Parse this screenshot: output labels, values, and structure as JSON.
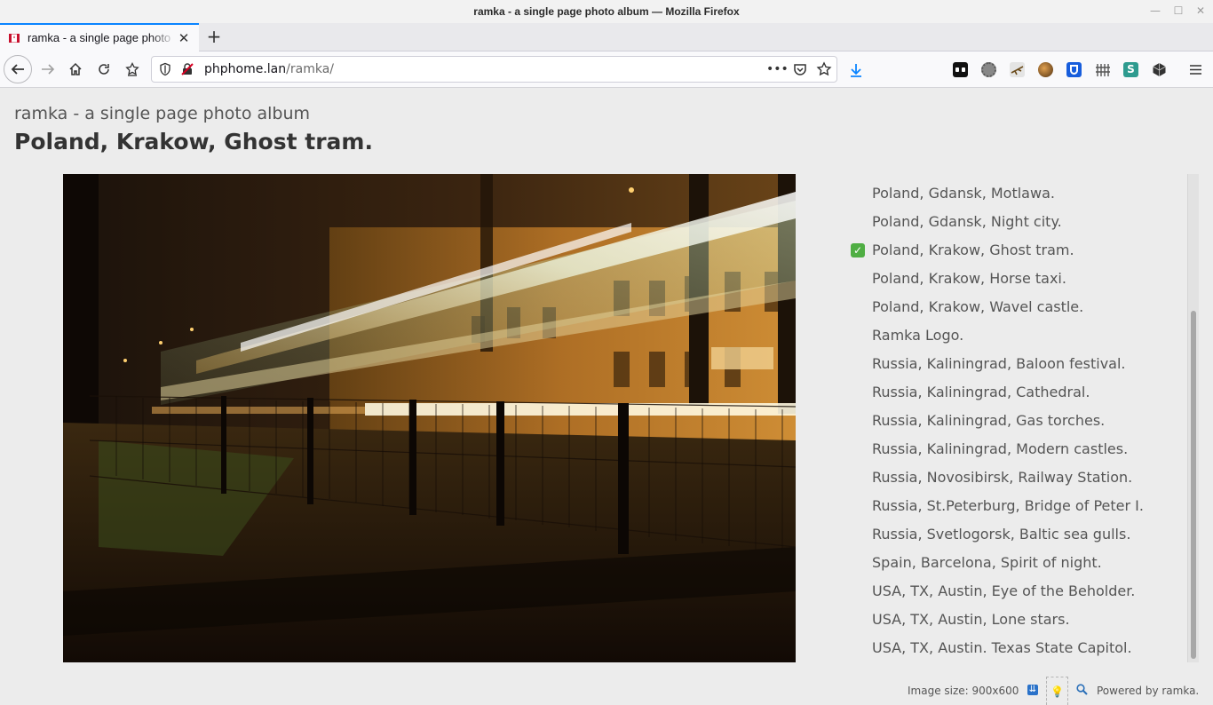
{
  "window": {
    "title": "ramka - a single page photo album — Mozilla Firefox"
  },
  "tab": {
    "title": "ramka - a single page photo album",
    "close_glyph": "✕",
    "new_tab_glyph": "+"
  },
  "urlbar": {
    "host": "phphome.lan",
    "path": "/ramka/"
  },
  "page": {
    "site_title": "ramka - a single page photo album",
    "photo_title": "Poland, Krakow, Ghost tram."
  },
  "album": {
    "items": [
      {
        "label": "Poland, Gdansk, Motlawa.",
        "selected": false
      },
      {
        "label": "Poland, Gdansk, Night city.",
        "selected": false
      },
      {
        "label": "Poland, Krakow, Ghost tram.",
        "selected": true
      },
      {
        "label": "Poland, Krakow, Horse taxi.",
        "selected": false
      },
      {
        "label": "Poland, Krakow, Wavel castle.",
        "selected": false
      },
      {
        "label": "Ramka Logo.",
        "selected": false
      },
      {
        "label": "Russia, Kaliningrad, Baloon festival.",
        "selected": false
      },
      {
        "label": "Russia, Kaliningrad, Cathedral.",
        "selected": false
      },
      {
        "label": "Russia, Kaliningrad, Gas torches.",
        "selected": false
      },
      {
        "label": "Russia, Kaliningrad, Modern castles.",
        "selected": false
      },
      {
        "label": "Russia, Novosibirsk, Railway Station.",
        "selected": false
      },
      {
        "label": "Russia, St.Peterburg, Bridge of Peter I.",
        "selected": false
      },
      {
        "label": "Russia, Svetlogorsk, Baltic sea gulls.",
        "selected": false
      },
      {
        "label": "Spain, Barcelona, Spirit of night.",
        "selected": false
      },
      {
        "label": "USA, TX, Austin, Eye of the Beholder.",
        "selected": false
      },
      {
        "label": "USA, TX, Austin, Lone stars.",
        "selected": false
      },
      {
        "label": "USA, TX, Austin. Texas State Capitol.",
        "selected": false
      }
    ],
    "check_glyph": "✓"
  },
  "footer": {
    "image_size": "Image size: 900x600",
    "powered_by": "Powered by ramka."
  },
  "colors": {
    "accent_tab": "#0a84ff",
    "check_green": "#4fae43"
  },
  "icons": {
    "back": "back-arrow-icon",
    "forward": "forward-arrow-icon",
    "home": "home-icon",
    "reload": "reload-icon",
    "bookmark": "bookmark-star-icon",
    "download": "download-icon",
    "menu": "hamburger-menu-icon"
  }
}
